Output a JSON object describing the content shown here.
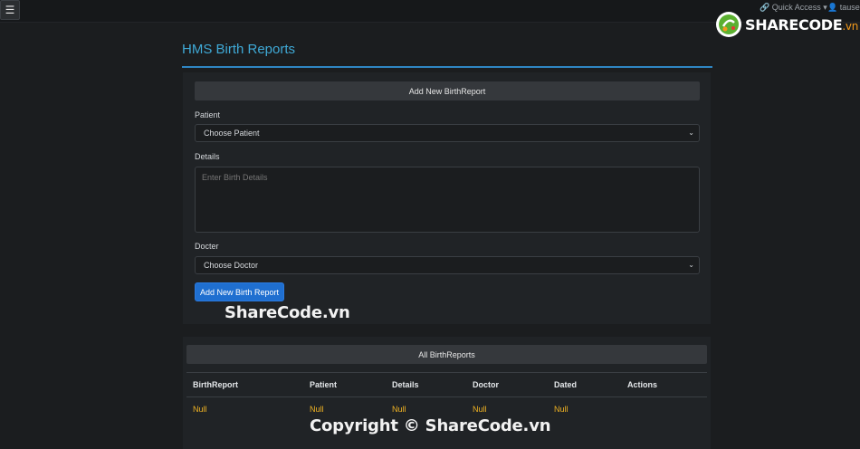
{
  "topbar": {
    "menu_icon": "hamburger-icon",
    "quick_access": "Quick Access",
    "user": "tausee"
  },
  "logo": {
    "text": "SHARECODE",
    "suffix": ".vn"
  },
  "page": {
    "title": "HMS Birth Reports"
  },
  "form": {
    "header": "Add New BirthReport",
    "patient_label": "Patient",
    "patient_value": "Choose Patient",
    "details_label": "Details",
    "details_placeholder": "Enter Birth Details",
    "doctor_label": "Docter",
    "doctor_value": "Choose Doctor",
    "submit_label": "Add New Birth Report"
  },
  "watermarks": {
    "top": "ShareCode.vn",
    "bottom": "Copyright © ShareCode.vn"
  },
  "list": {
    "header": "All BirthReports",
    "columns": [
      "BirthReport",
      "Patient",
      "Details",
      "Doctor",
      "Dated",
      "Actions"
    ],
    "rows": [
      [
        "Null",
        "Null",
        "Null",
        "Null",
        "Null",
        ""
      ]
    ]
  },
  "colors": {
    "accent": "#3fa9d6",
    "primary_button": "#1f6fd0",
    "null_value": "#f0b323",
    "logo_orange": "#f39a1c"
  }
}
